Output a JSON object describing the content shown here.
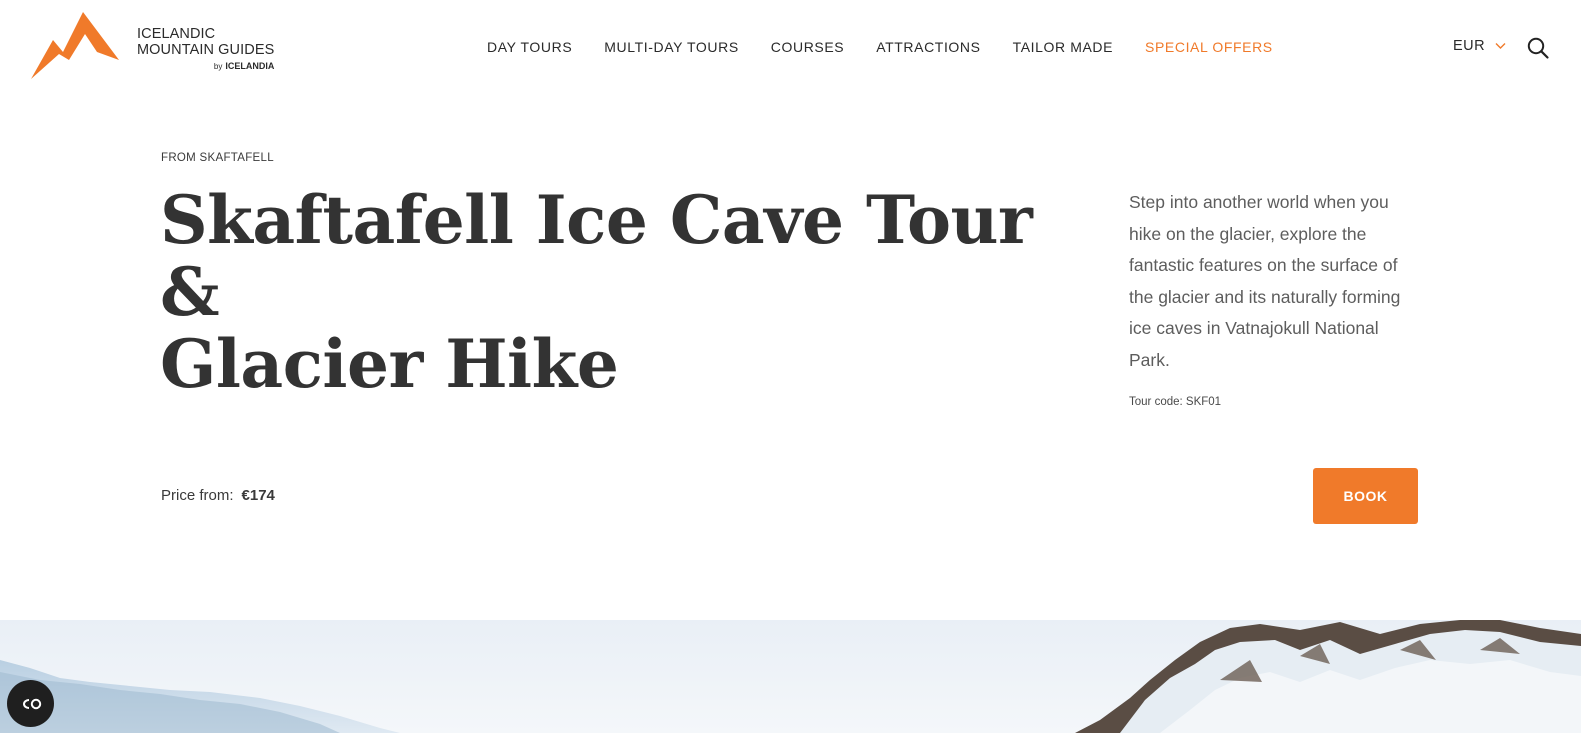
{
  "brand": {
    "name_line1": "ICELANDIC",
    "name_line2": "MOUNTAIN GUIDES",
    "by": "by",
    "sub": "ICELANDIA",
    "logo_color": "#f07a2a"
  },
  "nav": {
    "items": [
      {
        "label": "DAY TOURS"
      },
      {
        "label": "MULTI-DAY TOURS"
      },
      {
        "label": "COURSES"
      },
      {
        "label": "ATTRACTIONS"
      },
      {
        "label": "TAILOR MADE"
      },
      {
        "label": "SPECIAL OFFERS",
        "highlight": true
      }
    ]
  },
  "currency": {
    "selected": "EUR",
    "icon": "chevron-down-icon"
  },
  "search": {
    "icon": "search-icon"
  },
  "tour": {
    "eyebrow": "FROM SKAFTAFELL",
    "title_line1": "Skaftafell Ice Cave Tour &",
    "title_line2": "Glacier Hike",
    "description": "Step into another world when you hike on the glacier, explore the fantastic features on the surface of the glacier and its naturally forming ice caves in Vatnajokull National Park.",
    "tour_code": "Tour code: SKF01",
    "price_label": "Price from:",
    "price_value": "€174",
    "book_label": "BOOK"
  },
  "colors": {
    "accent": "#f07a2a",
    "text": "#333333",
    "muted": "#5d5d5d"
  },
  "cookie_button": {
    "icon": "cookie-settings-icon"
  }
}
